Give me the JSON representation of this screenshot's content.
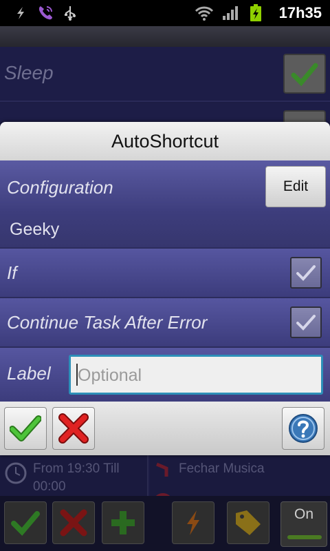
{
  "status_bar": {
    "time": "17h35",
    "icons": [
      "usb-debug-icon",
      "voice-call-icon",
      "usb-icon",
      "wifi-icon",
      "signal-icon",
      "battery-charging-icon"
    ]
  },
  "background": {
    "row1_label": "Sleep",
    "task_left_text_line1": "From 19:30 Till",
    "task_left_text_line2": "00:00",
    "task_right_text": "Fechar Musica",
    "toolbar_on_label": "On"
  },
  "dialog": {
    "title": "AutoShortcut",
    "configuration": {
      "label": "Configuration",
      "edit_label": "Edit",
      "value": "Geeky"
    },
    "if_row": {
      "label": "If",
      "checked": true
    },
    "continue_row": {
      "label": "Continue Task After Error",
      "checked": true
    },
    "label_row": {
      "label": "Label",
      "input_value": "",
      "placeholder": "Optional"
    }
  },
  "colors": {
    "accent_green": "#3fae2a",
    "accent_red": "#d02020",
    "input_focus": "#2d8fb8",
    "dialog_bg": "#4a4a8c"
  }
}
